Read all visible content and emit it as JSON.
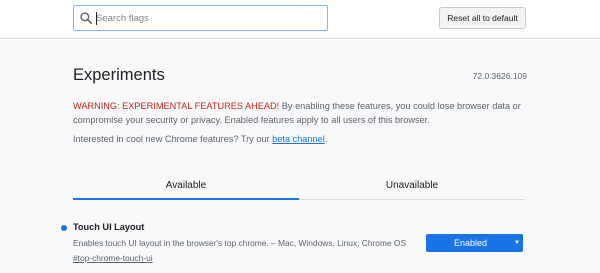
{
  "search": {
    "placeholder": "Search flags",
    "value": ""
  },
  "header": {
    "reset_label": "Reset all to default"
  },
  "page": {
    "title": "Experiments",
    "version": "72.0.3626.109",
    "warning_strong": "WARNING: EXPERIMENTAL FEATURES AHEAD!",
    "warning_rest": " By enabling these features, you could lose browser data or compromise your security or privacy. Enabled features apply to all users of this browser.",
    "interest_prefix": "Interested in cool new Chrome features? Try our ",
    "interest_link": "beta channel",
    "interest_suffix": "."
  },
  "tabs": [
    {
      "label": "Available",
      "active": true
    },
    {
      "label": "Unavailable",
      "active": false
    }
  ],
  "experiments": [
    {
      "name": "Touch UI Layout",
      "description": "Enables touch UI layout in the browser's top chrome. – Mac, Windows, Linux, Chrome OS",
      "link": "#top-chrome-touch-ui",
      "selected": "Enabled"
    }
  ],
  "colors": {
    "accent": "#1a73e8",
    "warning": "#c5221f",
    "body_bg": "#f8f9fa"
  }
}
